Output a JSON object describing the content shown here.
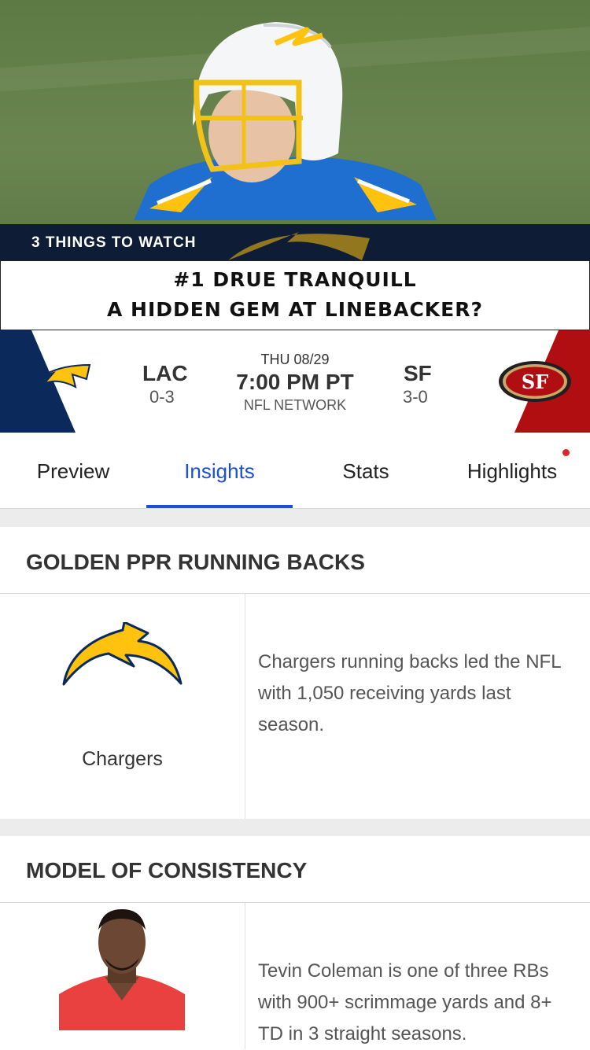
{
  "video": {
    "segment_label": "3 THINGS TO WATCH",
    "headline_line1": "#1 DRUE TRANQUILL",
    "headline_line2": "A HIDDEN GEM AT LINEBACKER?"
  },
  "game": {
    "home": {
      "abbr": "LAC",
      "record": "0-3",
      "logo": "chargers-bolt-icon",
      "color": "#0b2a5b"
    },
    "away": {
      "abbr": "SF",
      "record": "3-0",
      "logo": "49ers-logo",
      "color": "#b10e12"
    },
    "date": "THU 08/29",
    "time": "7:00 PM PT",
    "network": "NFL NETWORK"
  },
  "tabs": [
    {
      "label": "Preview",
      "active": false
    },
    {
      "label": "Insights",
      "active": true
    },
    {
      "label": "Stats",
      "active": false
    },
    {
      "label": "Highlights",
      "active": false,
      "notification_dot": true
    }
  ],
  "insights": [
    {
      "title": "GOLDEN PPR RUNNING BACKS",
      "subject": "Chargers",
      "image": "chargers-bolt-icon",
      "text": "Chargers running backs led the NFL with 1,050 receiving yards last season."
    },
    {
      "title": "MODEL OF CONSISTENCY",
      "image": "player-headshot",
      "text": "Tevin Coleman is one of three RBs with 900+ scrimmage yards and 8+ TD in 3 straight seasons."
    }
  ],
  "colors": {
    "accent": "#1d4fd1",
    "chargers_gold": "#ffc20e",
    "chargers_blue": "#0080c6",
    "niners_red": "#b10e12"
  }
}
